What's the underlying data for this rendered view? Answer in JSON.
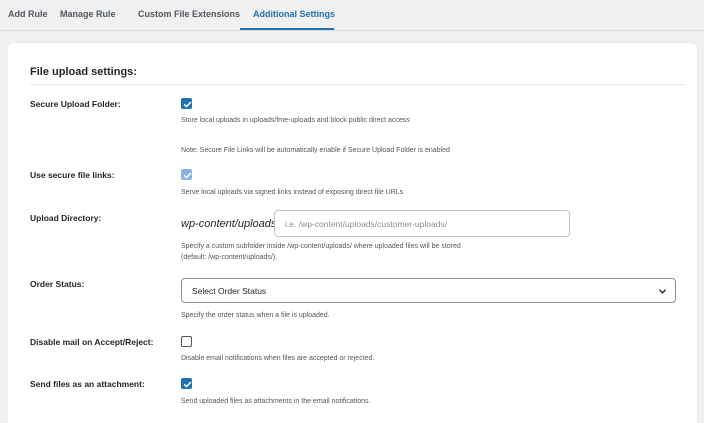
{
  "tabs": [
    {
      "label": "Add Rule",
      "active": false
    },
    {
      "label": "Manage Rule",
      "active": false
    },
    {
      "label": "Custom File Extensions",
      "active": false
    },
    {
      "label": "Additional Settings",
      "active": true
    }
  ],
  "accent_color": "#2271b1",
  "section": {
    "title": "File upload settings:"
  },
  "settings": {
    "secure_folder": {
      "label": "Secure Upload Folder:",
      "checked": true,
      "description": "Store local uploads in uploads/fme-uploads and block public direct access",
      "note": "Note: Secure File Links will be automatically enable if Secure Upload Folder is enabled"
    },
    "secure_links": {
      "label": "Use secure file links:",
      "checked": true,
      "disabled": true,
      "description": "Serve local uploads via signed links instead of exposing direct file URLs"
    },
    "upload_directory": {
      "label": "Upload Directory:",
      "prefix": "wp-content/uploads/:",
      "value": "",
      "placeholder": "i.e. /wp-content/uploads/customer-uploads/",
      "description_line1": "Specify a custom subfolder inside /wp-content/uploads/ where uploaded files will be stored",
      "description_line2": "(default: /wp-content/uploads/)."
    },
    "order_status": {
      "label": "Order Status:",
      "selected": "Select Order Status",
      "description": "Specify the order status when a file is uploaded."
    },
    "disable_mail": {
      "label": "Disable mail on Accept/Reject:",
      "checked": false,
      "description": "Disable email notifications when files are accepted or rejected."
    },
    "attachment": {
      "label": "Send files as an attachment:",
      "checked": true,
      "description": "Send uploaded files as attachments in the email notifications."
    }
  },
  "icons": {
    "checkbox": "check-icon",
    "select": "chevron-down-icon"
  }
}
